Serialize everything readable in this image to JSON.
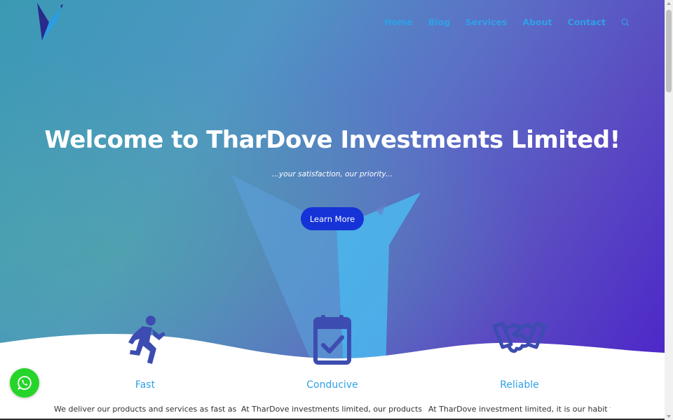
{
  "brand": {
    "logo_icon": "bird-logo-icon",
    "colors": {
      "nav_link": "#2fa0e8",
      "button": "#1533d6",
      "feature_icon": "#3d4cb0",
      "whatsapp": "#26d42a"
    }
  },
  "nav": {
    "items": [
      {
        "label": "Home"
      },
      {
        "label": "Blog"
      },
      {
        "label": "Services"
      },
      {
        "label": "About"
      },
      {
        "label": "Contact"
      }
    ],
    "search_icon": "search-icon"
  },
  "hero": {
    "title": "Welcome to TharDove Investments Limited!",
    "subtitle": "...your satisfaction, our priority...",
    "cta_label": "Learn More"
  },
  "features": [
    {
      "icon": "running-person-icon",
      "title": "Fast",
      "text": "We deliver our products and services as fast as"
    },
    {
      "icon": "calendar-check-icon",
      "title": "Conducive",
      "text": "At TharDove investments limited, our products and"
    },
    {
      "icon": "handshake-icon",
      "title": "Reliable",
      "text": "At TharDove investment limited, it is our habit to"
    }
  ],
  "floating": {
    "whatsapp_icon": "whatsapp-icon"
  }
}
